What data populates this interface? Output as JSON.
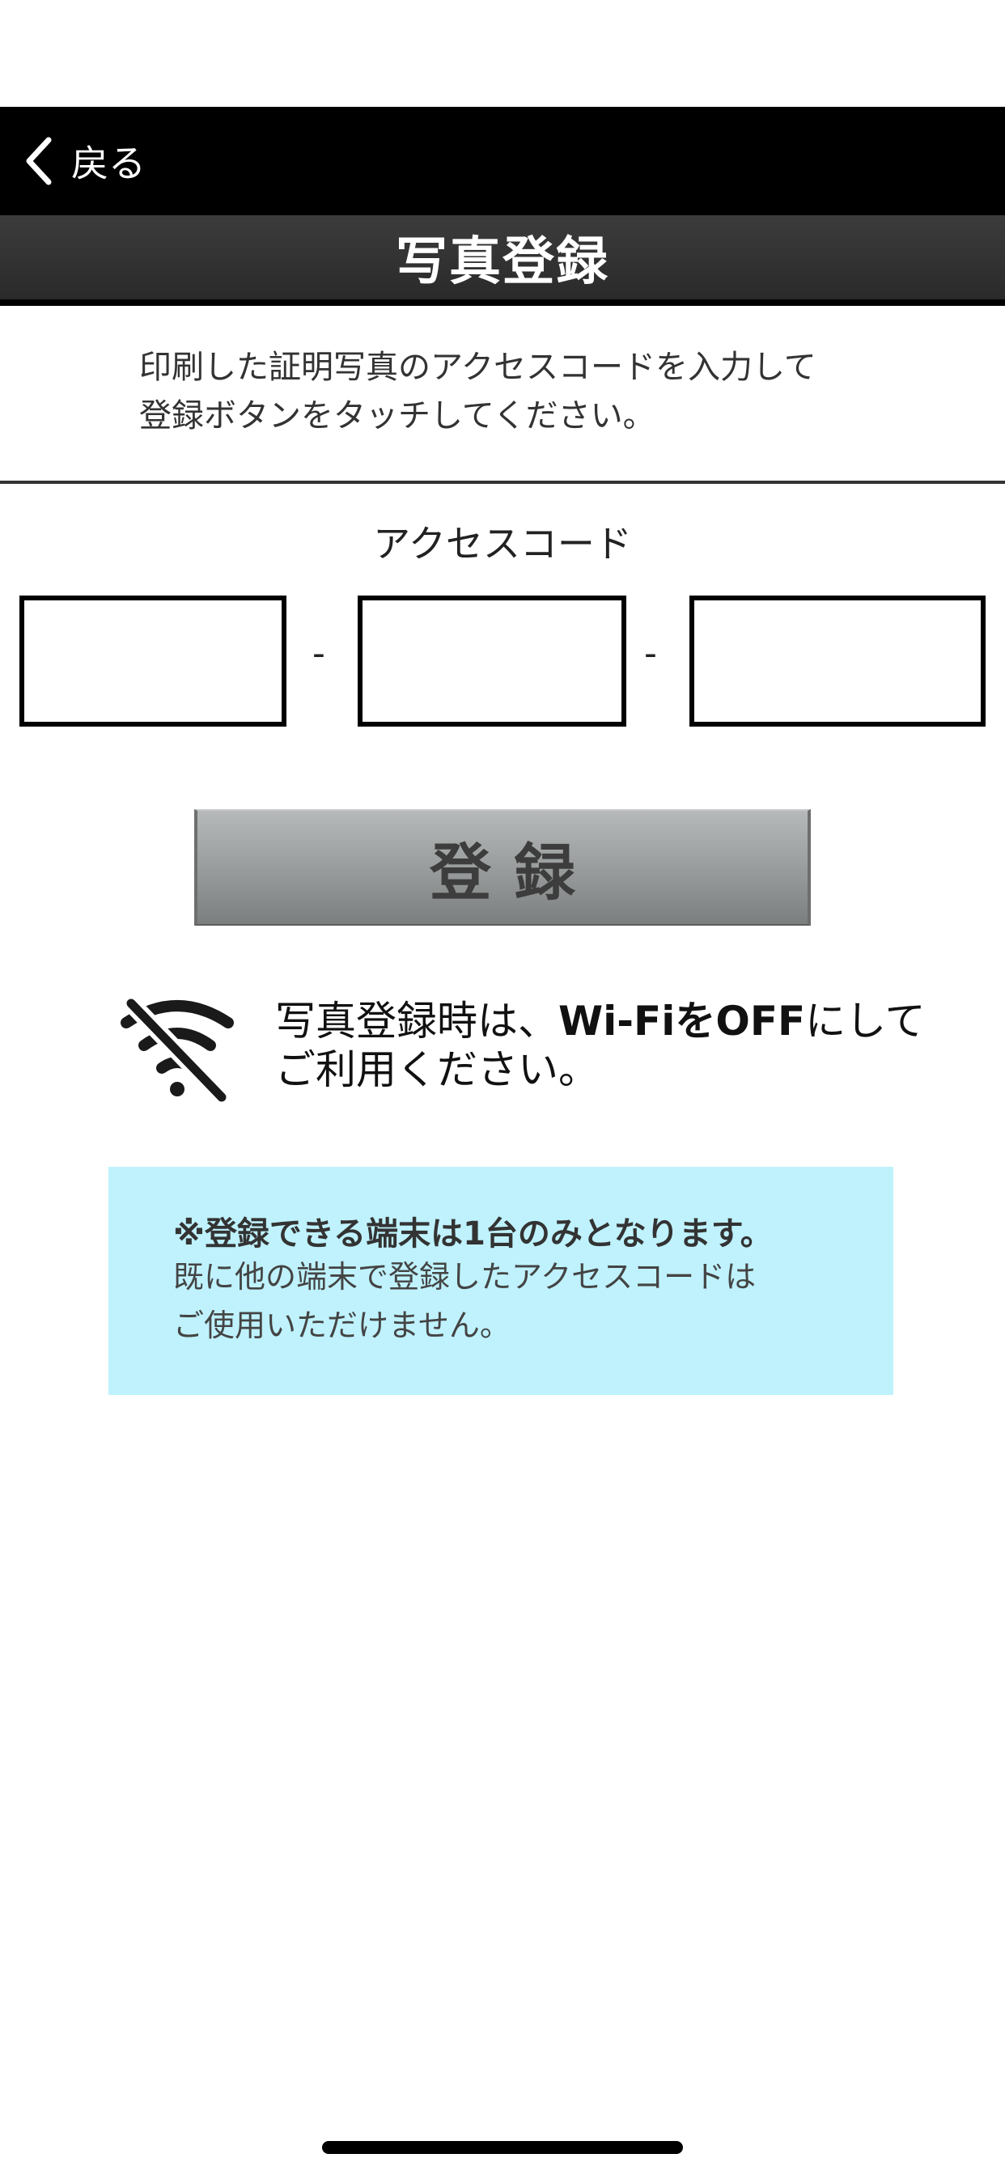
{
  "nav": {
    "back_label": "戻る"
  },
  "header": {
    "title": "写真登録"
  },
  "instruction": {
    "line1": "印刷した証明写真のアクセスコードを入力して",
    "line2": "登録ボタンをタッチしてください。"
  },
  "access_code": {
    "label": "アクセスコード",
    "fields": [
      {
        "value": "",
        "placeholder": ""
      },
      {
        "value": "",
        "placeholder": ""
      },
      {
        "value": "",
        "placeholder": ""
      }
    ],
    "separator": "-"
  },
  "register_button": {
    "label": "登録"
  },
  "wifi_notice": {
    "icon": "wifi-off-icon",
    "prefix": "写真登録時は、",
    "bold": "Wi-FiをOFF",
    "suffix": "にして",
    "line2": "ご利用ください。"
  },
  "notice": {
    "title": "※登録できる端末は1台のみとなります。",
    "line1": "既に他の端末で登録したアクセスコードは",
    "line2": "ご使用いただけません。",
    "background": "#bff2fd"
  }
}
